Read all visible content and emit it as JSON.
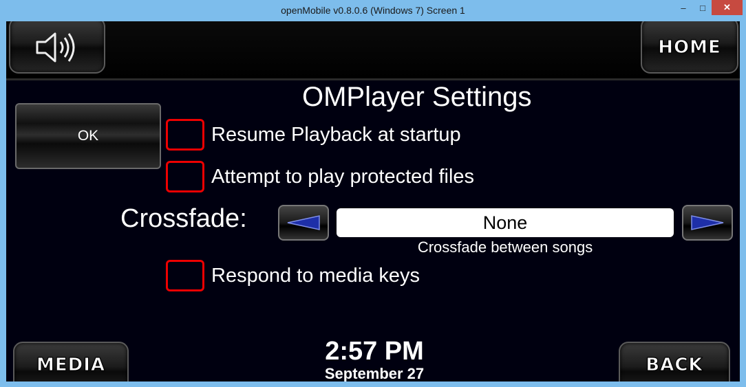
{
  "window": {
    "title": "openMobile v0.8.0.6 (Windows 7) Screen 1",
    "controls": {
      "minimize": "–",
      "maximize": "□",
      "close": "✕"
    }
  },
  "top_bar": {
    "speaker_icon": "speaker-icon",
    "home_label": "HOME"
  },
  "page": {
    "title": "OMPlayer Settings",
    "ok_label": "OK"
  },
  "settings": {
    "resume_playback": {
      "label": "Resume Playback at startup",
      "checked": false
    },
    "protected_files": {
      "label": "Attempt to play protected files",
      "checked": false
    },
    "media_keys": {
      "label": "Respond to media keys",
      "checked": false
    }
  },
  "crossfade": {
    "label": "Crossfade:",
    "value": "None",
    "caption": "Crossfade between songs",
    "arrow_color": "#1e2fa8"
  },
  "bottom_bar": {
    "media_label": "MEDIA",
    "back_label": "BACK",
    "time": "2:57 PM",
    "date": "September 27"
  }
}
